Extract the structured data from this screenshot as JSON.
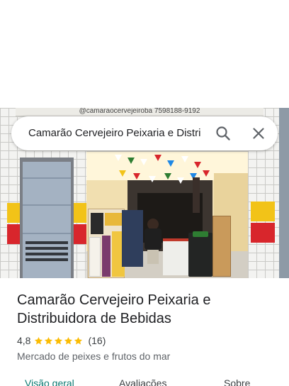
{
  "search": {
    "query": "Camarão Cervejeiro Peixaria e Distri"
  },
  "photo": {
    "sign_text": "@camaraocervejeiroba   7598188-9192"
  },
  "place": {
    "name": "Camarão Cervejeiro Peixaria e Distribuidora de Bebidas",
    "rating": "4,8",
    "stars": 5,
    "review_count": "(16)",
    "category": "Mercado de peixes e frutos do mar"
  },
  "tabs": [
    {
      "label": "Visão geral",
      "active": true
    },
    {
      "label": "Avaliações",
      "active": false
    },
    {
      "label": "Sobre",
      "active": false
    }
  ],
  "colors": {
    "accent": "#0b7a72",
    "star": "#fbbc04",
    "band_yellow": "#f2c318",
    "band_red": "#d8262c"
  },
  "icons": {
    "search": "search-icon",
    "close": "close-icon",
    "star": "star-icon"
  }
}
